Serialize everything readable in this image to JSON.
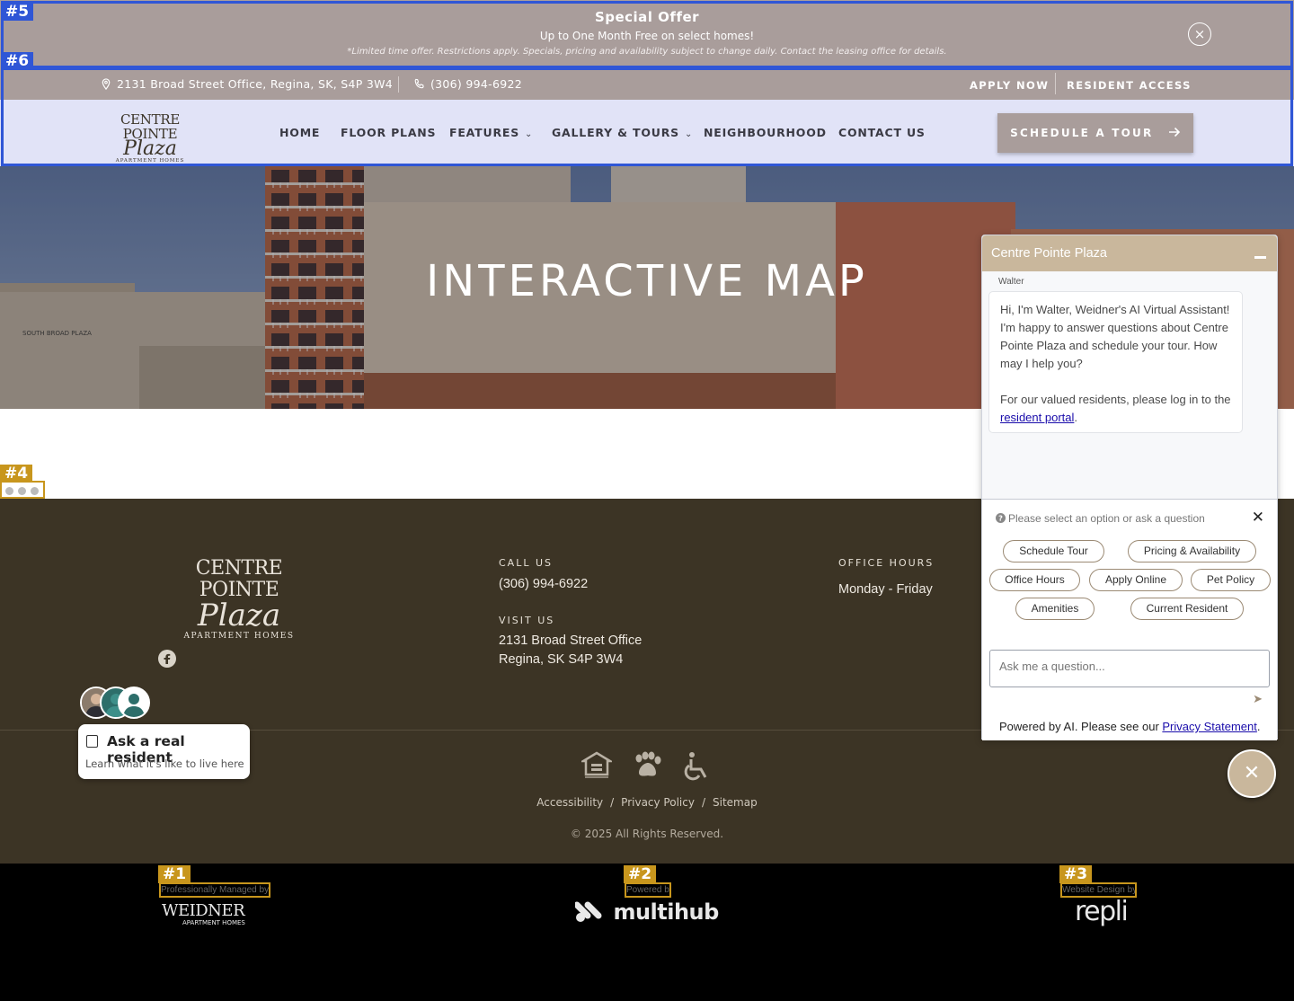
{
  "offer": {
    "title": "Special Offer",
    "subtitle": "Up to One Month Free on select homes!",
    "disclaimer": "*Limited time offer. Restrictions apply. Specials, pricing and availability subject to change daily. Contact the leasing office for details.",
    "close_icon": "×"
  },
  "utility": {
    "address": "2131 Broad Street Office, Regina, SK, S4P 3W4",
    "phone": "(306) 994-6922",
    "apply_now": "APPLY NOW",
    "resident_access": "RESIDENT ACCESS"
  },
  "brand": {
    "line1": "CENTRE POINTE",
    "line2": "Plaza",
    "line3": "APARTMENT HOMES"
  },
  "nav": {
    "items": [
      "HOME",
      "FLOOR PLANS",
      "FEATURES",
      "GALLERY & TOURS",
      "NEIGHBOURHOOD",
      "CONTACT US"
    ],
    "schedule_tour": "SCHEDULE A TOUR"
  },
  "hero": {
    "title": "INTERACTIVE MAP",
    "building_sign": "SOUTH BROAD PLAZA"
  },
  "footer": {
    "call_label": "CALL US",
    "phone": "(306) 994-6922",
    "visit_label": "VISIT US",
    "address_line1": "2131 Broad Street Office",
    "address_line2": "Regina, SK S4P 3W4",
    "hours_label": "OFFICE HOURS",
    "hours_days": "Monday - Friday",
    "links": [
      "Accessibility",
      "Privacy Policy",
      "Sitemap"
    ],
    "copyright": "© 2025 All Rights Reserved."
  },
  "credits": {
    "managed_label": "Professionally Managed by",
    "managed_name": "WEIDNER",
    "managed_sub": "APARTMENT HOMES",
    "powered_label": "Powered by",
    "powered_name": "multihub",
    "design_label": "Website Design by",
    "design_name": "repli"
  },
  "ask": {
    "title": "Ask a real resident",
    "subtitle": "Learn what it's like to live here"
  },
  "chat": {
    "header": "Centre Pointe Plaza",
    "agent": "Walter",
    "message_p1": "Hi, I'm Walter, Weidner's AI Virtual Assistant! I'm happy to answer questions about Centre Pointe Plaza and schedule your tour. How may I help you?",
    "message_p2_pre": "For our valued residents, please log in to the ",
    "message_link": "resident portal",
    "message_p2_post": ".",
    "prompt": "Please select an option or ask a question",
    "options": [
      "Schedule Tour",
      "Pricing & Availability",
      "Office Hours",
      "Apply Online",
      "Pet Policy",
      "Amenities",
      "Current Resident"
    ],
    "input_placeholder": "Ask me a question...",
    "powered_pre": "Powered by AI. Please see our ",
    "powered_link": "Privacy Statement",
    "powered_post": "."
  },
  "annotations": [
    "#1",
    "#2",
    "#3",
    "#4",
    "#5",
    "#6"
  ],
  "colors": {
    "offer_bg": "#a99d9b",
    "nav_bg": "#e1e3f7",
    "footer_bg": "#3c3425",
    "chat_accent": "#c9b79c",
    "annotation_blue": "#2f56d6",
    "annotation_gold": "#c8961d"
  }
}
